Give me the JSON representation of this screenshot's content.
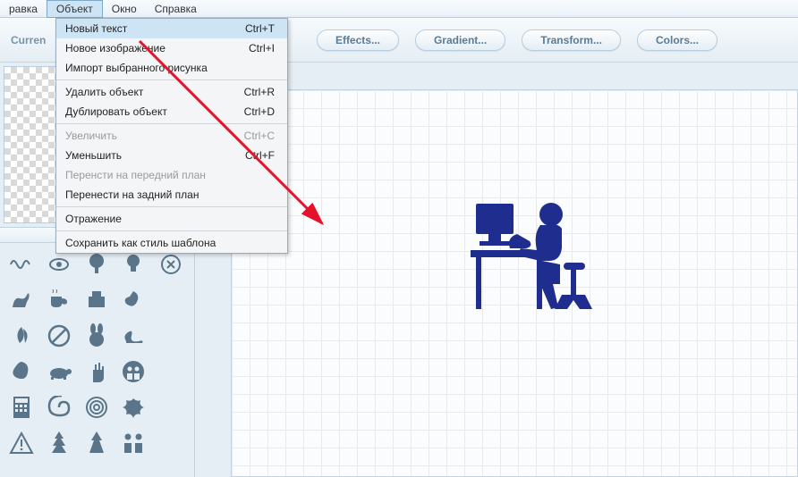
{
  "menubar": {
    "items": [
      {
        "label": "равка"
      },
      {
        "label": "Объект",
        "active": true
      },
      {
        "label": "Окно"
      },
      {
        "label": "Справка"
      }
    ]
  },
  "toolbar": {
    "left_label": "Curren",
    "buttons": [
      {
        "label": "Effects..."
      },
      {
        "label": "Gradient..."
      },
      {
        "label": "Transform..."
      },
      {
        "label": "Colors..."
      }
    ]
  },
  "dropdown": {
    "items": [
      {
        "label": "Новый текст",
        "shortcut": "Ctrl+T",
        "highlight": true
      },
      {
        "label": "Новое изображение",
        "shortcut": "Ctrl+I"
      },
      {
        "label": "Импорт выбранного рисунка"
      },
      {
        "sep": true
      },
      {
        "label": "Удалить объект",
        "shortcut": "Ctrl+R"
      },
      {
        "label": "Дублировать объект",
        "shortcut": "Ctrl+D"
      },
      {
        "sep": true
      },
      {
        "label": "Увеличить",
        "shortcut": "Ctrl+C",
        "disabled": true
      },
      {
        "label": "Уменьшить",
        "shortcut": "Ctrl+F"
      },
      {
        "label": "Перенсти на передний план",
        "disabled": true
      },
      {
        "label": "Перенести на задний план"
      },
      {
        "sep": true
      },
      {
        "label": "Отражение"
      },
      {
        "sep": true
      },
      {
        "label": "Сохранить как стиль шаблона"
      }
    ]
  },
  "shapes": {
    "icons": [
      "squiggle-icon",
      "eye-icon",
      "tree2-icon",
      "bulb-icon",
      "logo-icon",
      "kangaroo-icon",
      "cup-icon",
      "fax-icon",
      "swirl2-icon",
      "blank-icon",
      "leaf-icon",
      "nosmoking-icon",
      "bunny-icon",
      "swan-icon",
      "blank-icon",
      "blob-icon",
      "turtle-icon",
      "hand-icon",
      "family-icon",
      "blank-icon",
      "calc-icon",
      "spiral-icon",
      "spiral2-icon",
      "splat-icon",
      "blank-icon",
      "warning-icon",
      "pine-icon",
      "pine2-icon",
      "people-icon",
      "blank-icon"
    ]
  },
  "colors": {
    "accent": "#1f2e8e"
  }
}
